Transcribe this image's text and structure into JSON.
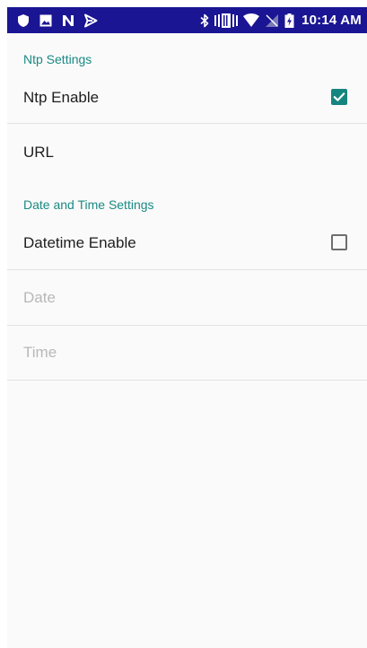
{
  "status_bar": {
    "time": "10:14 AM",
    "left_icons": [
      "shield-icon",
      "image-icon",
      "n-notification-icon",
      "send-icon"
    ],
    "right_icons": [
      "bluetooth-icon",
      "vibrate-icon",
      "wifi-icon",
      "no-sim-icon",
      "battery-charging-icon"
    ]
  },
  "sections": [
    {
      "header": "Ntp Settings",
      "items": [
        {
          "label": "Ntp Enable",
          "type": "checkbox",
          "checked": true,
          "enabled": true
        },
        {
          "label": "URL",
          "type": "text",
          "enabled": true
        }
      ]
    },
    {
      "header": "Date and Time Settings",
      "items": [
        {
          "label": "Datetime Enable",
          "type": "checkbox",
          "checked": false,
          "enabled": true
        },
        {
          "label": "Date",
          "type": "text",
          "enabled": false
        },
        {
          "label": "Time",
          "type": "text",
          "enabled": false
        }
      ]
    }
  ],
  "colors": {
    "status_bar": "#1a1593",
    "accent": "#15857f",
    "section_header": "#1a8a84",
    "background": "#fafafa",
    "text_primary": "#1e1e1e",
    "text_disabled": "#b8b8b8",
    "divider": "#e2e2e2"
  }
}
